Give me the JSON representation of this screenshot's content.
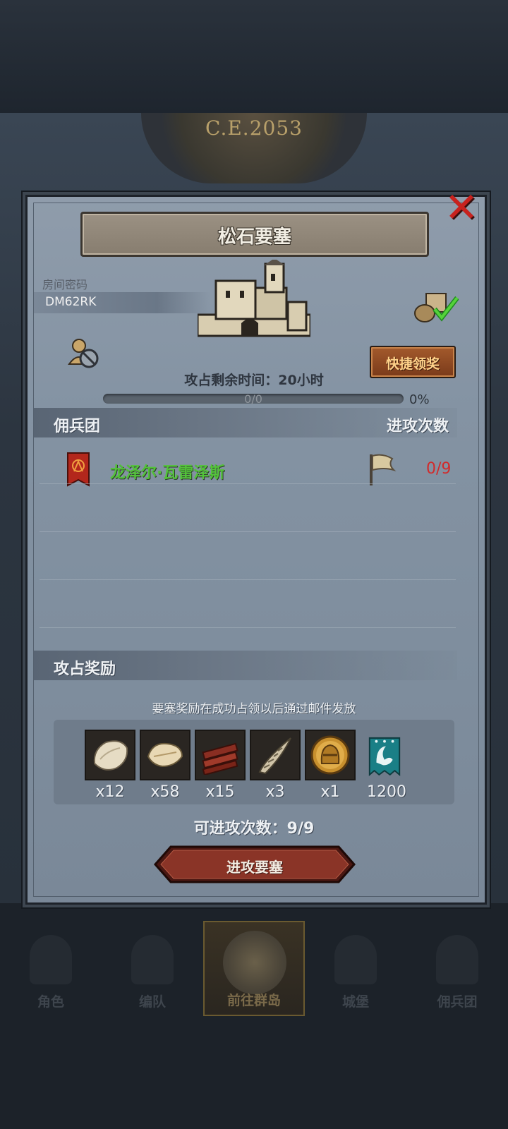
{
  "background": {
    "era_label": "C.E.2053"
  },
  "dialog": {
    "title": "松石要塞",
    "room_code_label": "房间密码",
    "room_code": "DM62RK",
    "quick_claim_label": "快捷领奖",
    "time_remaining": "攻占剩余时间：20小时",
    "progress": {
      "text": "0/0",
      "percent_label": "0%",
      "fraction": 0.0
    },
    "mercenary_section": {
      "title": "佣兵团",
      "right_header": "进攻次数"
    },
    "mercenaries": [
      {
        "name": "龙泽尔·瓦雷泽斯",
        "attacks": "0/9"
      }
    ],
    "rewards_section": {
      "title": "攻占奖励",
      "note": "要塞奖励在成功占领以后通过邮件发放",
      "items": [
        {
          "icon": "fur-pelt-icon",
          "qty": "x12"
        },
        {
          "icon": "leather-hide-icon",
          "qty": "x58"
        },
        {
          "icon": "wood-planks-icon",
          "qty": "x15"
        },
        {
          "icon": "horn-icon",
          "qty": "x3"
        },
        {
          "icon": "knight-helmet-coin-icon",
          "qty": "x1"
        },
        {
          "icon": "guild-banner-icon",
          "qty": "1200"
        }
      ]
    },
    "attacks_left": "可进攻次数：9/9",
    "attack_button": "进攻要塞"
  },
  "nav": {
    "items": [
      {
        "label": "角色",
        "icon": "character-icon"
      },
      {
        "label": "编队",
        "icon": "formation-icon"
      },
      {
        "label": "前往群岛",
        "icon": "compass-icon",
        "active": true
      },
      {
        "label": "城堡",
        "icon": "castle-icon"
      },
      {
        "label": "佣兵团",
        "icon": "mercenary-icon"
      }
    ]
  },
  "colors": {
    "accent_green": "#53c23a",
    "alert_red": "#d12b2b",
    "gold": "#ffd28a"
  }
}
